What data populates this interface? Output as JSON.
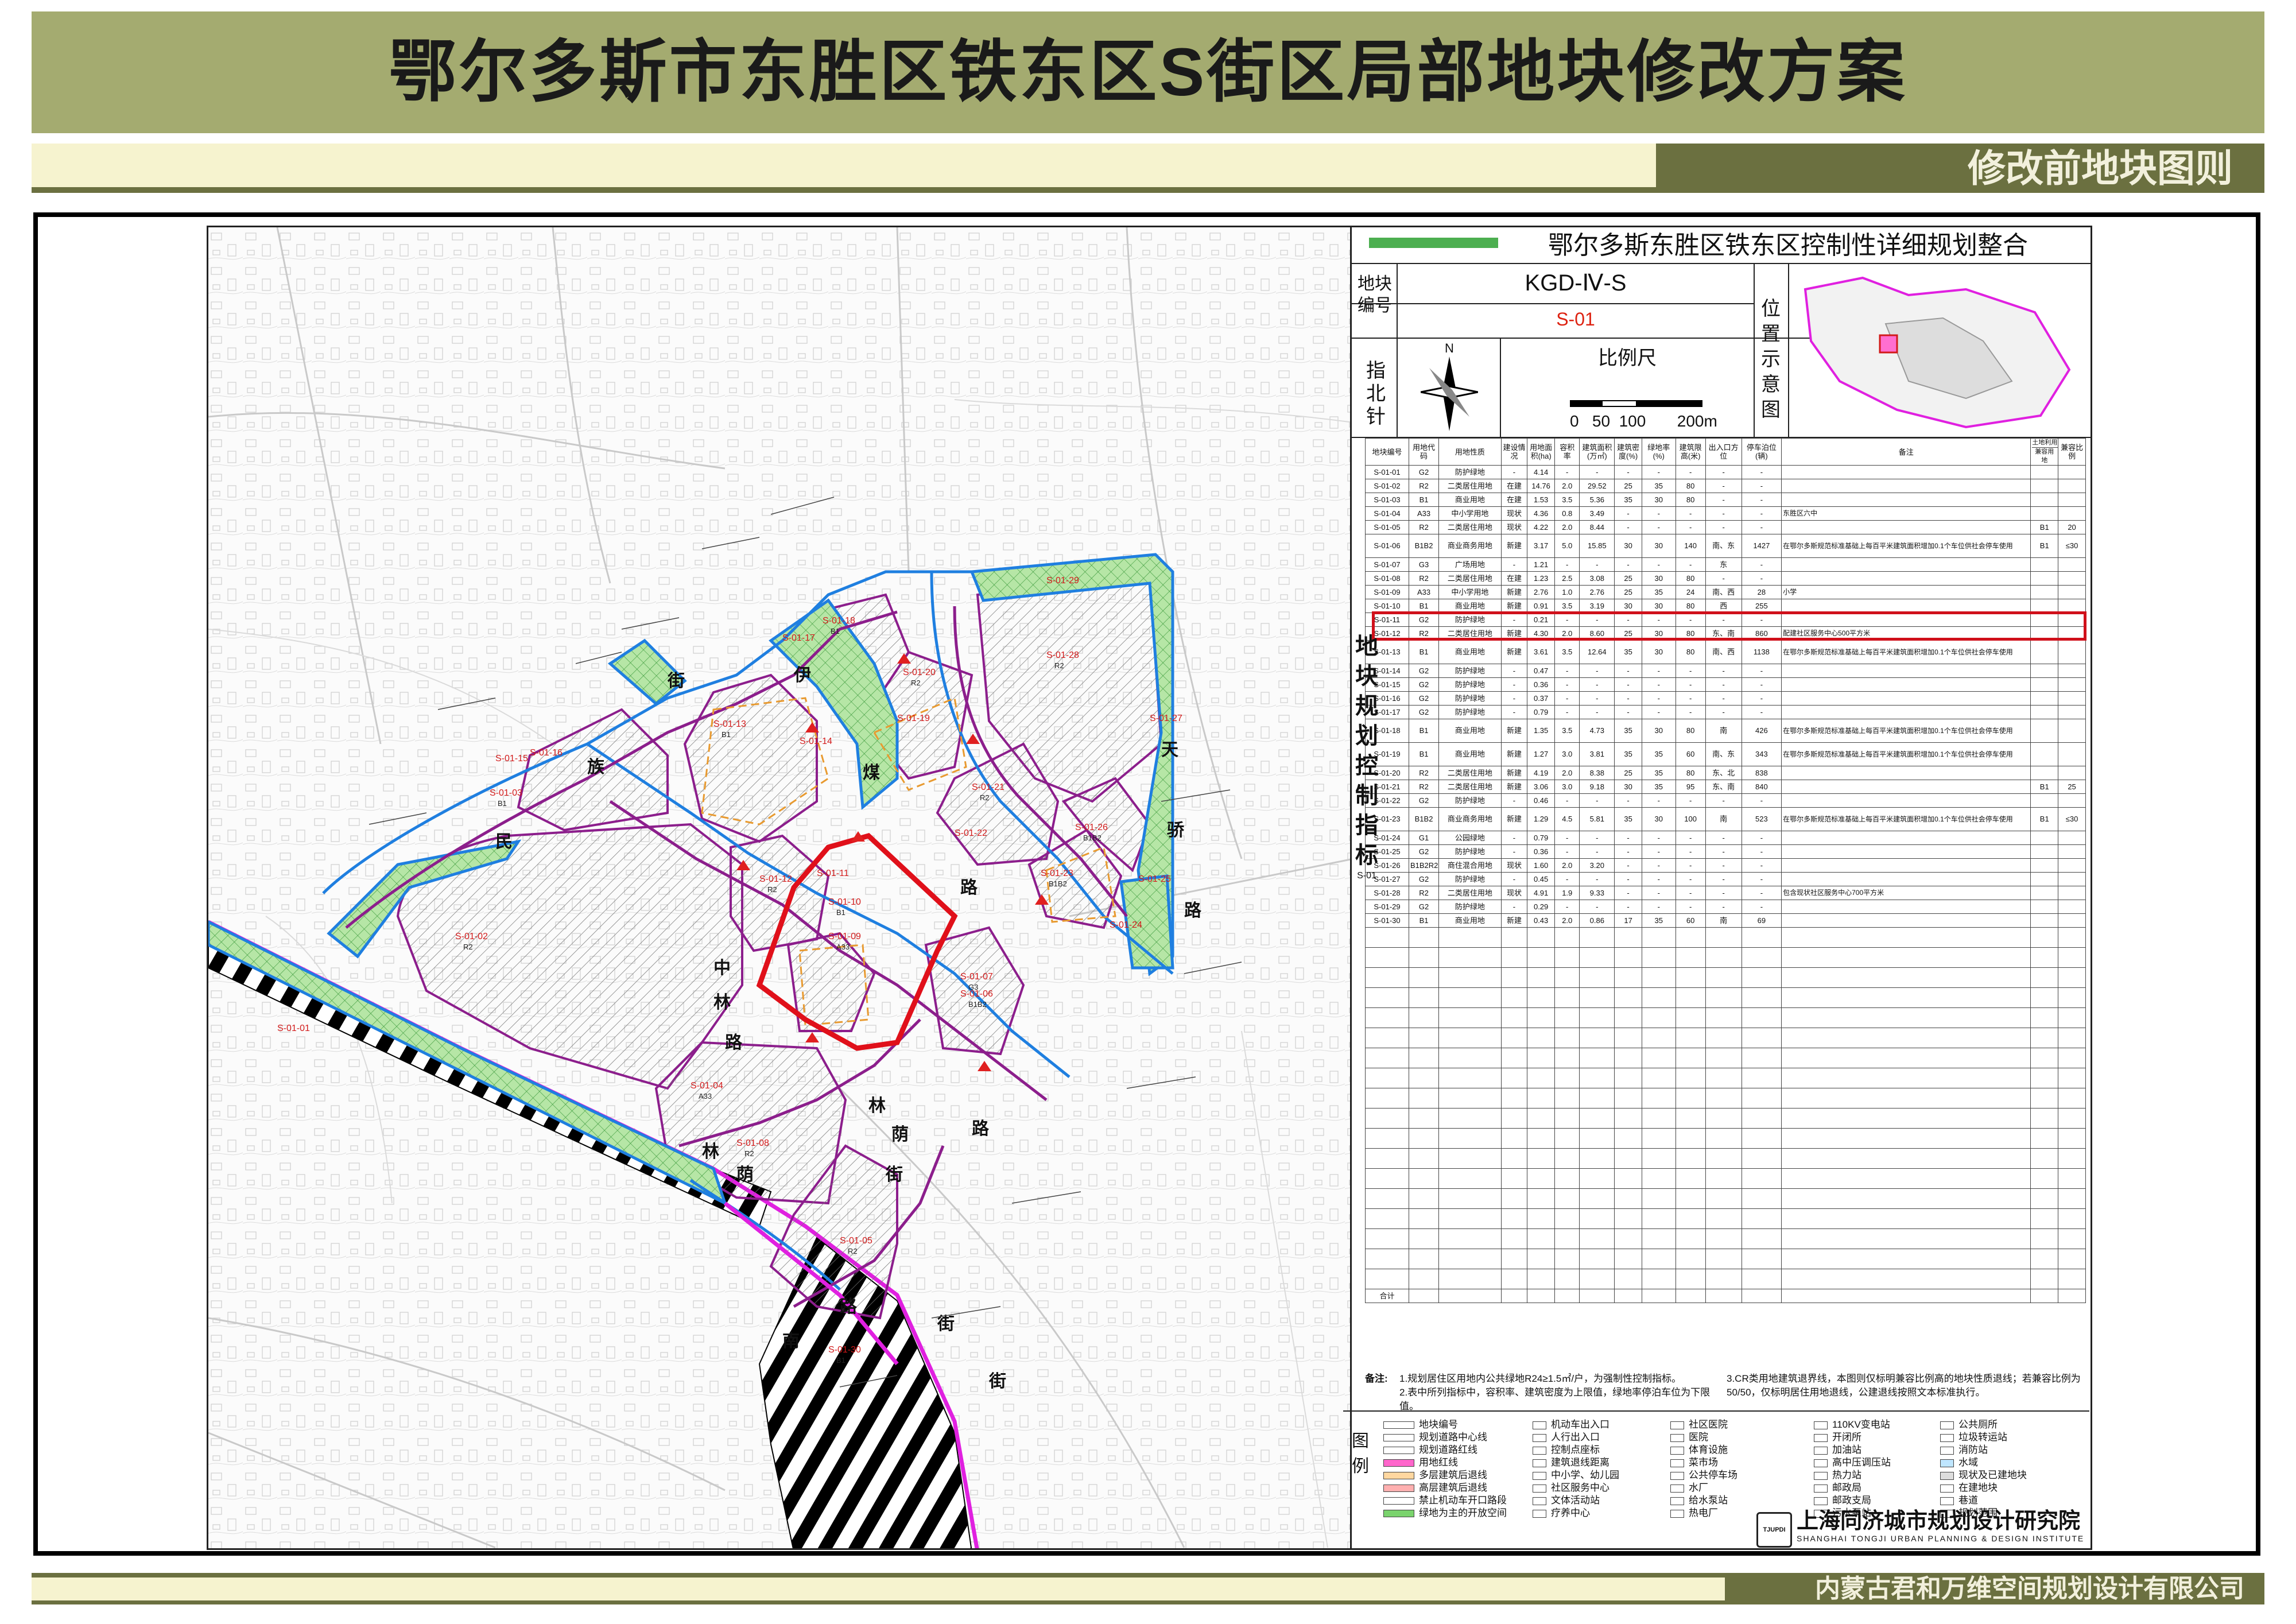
{
  "title": "鄂尔多斯市东胜区铁东区S街区局部地块修改方案",
  "subtitle": "修改前地块图则",
  "company": "内蒙古君和万维空间规划设计有限公司",
  "panel": {
    "title": "鄂尔多斯东胜区铁东区控制性详细规划整合",
    "block_label": "地块编号",
    "block_code": "KGD-Ⅳ-S",
    "block_sub": "S-01",
    "north_label": "指北针",
    "north_letter": "N",
    "scale_label": "比例尺",
    "scale_ticks": "0   50  100       200m",
    "location_label": "位置示意图",
    "vertical_label": "地块规划控制指标",
    "vertical_small": "S-01",
    "headers": [
      "地块编号",
      "用地代码",
      "用地性质",
      "建设情况",
      "用地面积(ha)",
      "容积率",
      "建筑面积(万㎡)",
      "建筑密度(%)",
      "绿地率(%)",
      "建筑限高(米)",
      "出入口方位",
      "停车泊位(辆)",
      "备注",
      "兼容用地",
      "兼容比例"
    ],
    "compat_header": "土地利用兼容性规定",
    "rows": [
      [
        "S-01-01",
        "G2",
        "防护绿地",
        "-",
        "4.14",
        "-",
        "-",
        "-",
        "-",
        "-",
        "-",
        "-",
        "",
        "",
        ""
      ],
      [
        "S-01-02",
        "R2",
        "二类居住用地",
        "在建",
        "14.76",
        "2.0",
        "29.52",
        "25",
        "35",
        "80",
        "-",
        "-",
        "",
        "",
        ""
      ],
      [
        "S-01-03",
        "B1",
        "商业用地",
        "在建",
        "1.53",
        "3.5",
        "5.36",
        "35",
        "30",
        "80",
        "-",
        "-",
        "",
        "",
        ""
      ],
      [
        "S-01-04",
        "A33",
        "中小学用地",
        "现状",
        "4.36",
        "0.8",
        "3.49",
        "-",
        "-",
        "-",
        "-",
        "-",
        "东胜区六中",
        "",
        ""
      ],
      [
        "S-01-05",
        "R2",
        "二类居住用地",
        "现状",
        "4.22",
        "2.0",
        "8.44",
        "-",
        "-",
        "-",
        "-",
        "-",
        "",
        "B1",
        "20"
      ],
      [
        "S-01-06",
        "B1B2",
        "商业商务用地",
        "新建",
        "3.17",
        "5.0",
        "15.85",
        "30",
        "30",
        "140",
        "南、东",
        "1427",
        "在鄂尔多斯规范标准基础上每百平米建筑面积增加0.1个车位供社会停车使用",
        "B1",
        "≤30"
      ],
      [
        "S-01-07",
        "G3",
        "广场用地",
        "-",
        "1.21",
        "-",
        "-",
        "-",
        "-",
        "-",
        "东",
        "-",
        "",
        "",
        ""
      ],
      [
        "S-01-08",
        "R2",
        "二类居住用地",
        "在建",
        "1.23",
        "2.5",
        "3.08",
        "25",
        "30",
        "80",
        "-",
        "-",
        "",
        "",
        ""
      ],
      [
        "S-01-09",
        "A33",
        "中小学用地",
        "新建",
        "2.76",
        "1.0",
        "2.76",
        "25",
        "35",
        "24",
        "南、西",
        "28",
        "小学",
        "",
        ""
      ],
      [
        "S-01-10",
        "B1",
        "商业用地",
        "新建",
        "0.91",
        "3.5",
        "3.19",
        "30",
        "30",
        "80",
        "西",
        "255",
        "",
        "",
        ""
      ],
      [
        "S-01-11",
        "G2",
        "防护绿地",
        "-",
        "0.21",
        "-",
        "-",
        "-",
        "-",
        "-",
        "-",
        "-",
        "",
        "",
        ""
      ],
      [
        "S-01-12",
        "R2",
        "二类居住用地",
        "新建",
        "4.30",
        "2.0",
        "8.60",
        "25",
        "30",
        "80",
        "东、南",
        "860",
        "配建社区服务中心500平方米",
        "",
        ""
      ],
      [
        "S-01-13",
        "B1",
        "商业用地",
        "新建",
        "3.61",
        "3.5",
        "12.64",
        "35",
        "30",
        "80",
        "南、西",
        "1138",
        "在鄂尔多斯规范标准基础上每百平米建筑面积增加0.1个车位供社会停车使用",
        "",
        ""
      ],
      [
        "S-01-14",
        "G2",
        "防护绿地",
        "-",
        "0.47",
        "-",
        "-",
        "-",
        "-",
        "-",
        "-",
        "-",
        "",
        "",
        ""
      ],
      [
        "S-01-15",
        "G2",
        "防护绿地",
        "-",
        "0.36",
        "-",
        "-",
        "-",
        "-",
        "-",
        "-",
        "-",
        "",
        "",
        ""
      ],
      [
        "S-01-16",
        "G2",
        "防护绿地",
        "-",
        "0.37",
        "-",
        "-",
        "-",
        "-",
        "-",
        "-",
        "-",
        "",
        "",
        ""
      ],
      [
        "S-01-17",
        "G2",
        "防护绿地",
        "-",
        "0.79",
        "-",
        "-",
        "-",
        "-",
        "-",
        "-",
        "-",
        "",
        "",
        ""
      ],
      [
        "S-01-18",
        "B1",
        "商业用地",
        "新建",
        "1.35",
        "3.5",
        "4.73",
        "35",
        "30",
        "80",
        "南",
        "426",
        "在鄂尔多斯规范标准基础上每百平米建筑面积增加0.1个车位供社会停车使用",
        "",
        ""
      ],
      [
        "S-01-19",
        "B1",
        "商业用地",
        "新建",
        "1.27",
        "3.0",
        "3.81",
        "35",
        "35",
        "60",
        "南、东",
        "343",
        "在鄂尔多斯规范标准基础上每百平米建筑面积增加0.1个车位供社会停车使用",
        "",
        ""
      ],
      [
        "S-01-20",
        "R2",
        "二类居住用地",
        "新建",
        "4.19",
        "2.0",
        "8.38",
        "25",
        "35",
        "80",
        "东、北",
        "838",
        "",
        "",
        ""
      ],
      [
        "S-01-21",
        "R2",
        "二类居住用地",
        "新建",
        "3.06",
        "3.0",
        "9.18",
        "30",
        "35",
        "95",
        "东、南",
        "840",
        "",
        "B1",
        "25"
      ],
      [
        "S-01-22",
        "G2",
        "防护绿地",
        "-",
        "0.46",
        "-",
        "-",
        "-",
        "-",
        "-",
        "-",
        "-",
        "",
        "",
        ""
      ],
      [
        "S-01-23",
        "B1B2",
        "商业商务用地",
        "新建",
        "1.29",
        "4.5",
        "5.81",
        "35",
        "30",
        "100",
        "南",
        "523",
        "在鄂尔多斯规范标准基础上每百平米建筑面积增加0.1个车位供社会停车使用",
        "B1",
        "≤30"
      ],
      [
        "S-01-24",
        "G1",
        "公园绿地",
        "-",
        "0.79",
        "-",
        "-",
        "-",
        "-",
        "-",
        "-",
        "-",
        "",
        "",
        ""
      ],
      [
        "S-01-25",
        "G2",
        "防护绿地",
        "-",
        "0.36",
        "-",
        "-",
        "-",
        "-",
        "-",
        "-",
        "-",
        "",
        "",
        ""
      ],
      [
        "S-01-26",
        "B1B2R2",
        "商住混合用地",
        "现状",
        "1.60",
        "2.0",
        "3.20",
        "-",
        "-",
        "-",
        "-",
        "-",
        "",
        "",
        ""
      ],
      [
        "S-01-27",
        "G2",
        "防护绿地",
        "-",
        "0.45",
        "-",
        "-",
        "-",
        "-",
        "-",
        "-",
        "-",
        "",
        "",
        ""
      ],
      [
        "S-01-28",
        "R2",
        "二类居住用地",
        "现状",
        "4.91",
        "1.9",
        "9.33",
        "-",
        "-",
        "-",
        "-",
        "-",
        "包含现状社区服务中心700平方米",
        "",
        ""
      ],
      [
        "S-01-29",
        "G2",
        "防护绿地",
        "-",
        "0.29",
        "-",
        "-",
        "-",
        "-",
        "-",
        "-",
        "-",
        "",
        "",
        ""
      ],
      [
        "S-01-30",
        "B1",
        "商业用地",
        "新建",
        "0.43",
        "2.0",
        "0.86",
        "17",
        "35",
        "60",
        "南",
        "69",
        "",
        "",
        ""
      ]
    ],
    "total_label": "合计",
    "notes_label": "备注:",
    "notes_left": [
      "1.规划居住区用地内公共绿地R24≥1.5㎡/户，为强制性控制指标。",
      "2.表中所列指标中，容积率、建筑密度为上限值，绿地率停泊车位为下限值。"
    ],
    "notes_right": [
      "3.CR类用地建筑退界线，本图则仅标明兼容比例高的地块性质退线；若兼容比例为50/50，仅标明居住用地退线，公建退线按照文本标准执行。"
    ],
    "legend_label": "图例",
    "legend": [
      {
        "t": "地块编号",
        "c": "#ffffff"
      },
      {
        "t": "规划道路中心线",
        "c": "#ffffff"
      },
      {
        "t": "规划道路红线",
        "c": "#ffffff"
      },
      {
        "t": "用地红线",
        "c": "#ff66cc"
      },
      {
        "t": "多层建筑后退线",
        "c": "#ffd7a0"
      },
      {
        "t": "高层建筑后退线",
        "c": "#ffb0b0"
      },
      {
        "t": "禁止机动车开口路段",
        "c": "#ffffff"
      },
      {
        "t": "绿地为主的开放空间",
        "c": "#7ad36d"
      },
      {
        "t": "机动车出入口",
        "c": "#ffffff"
      },
      {
        "t": "人行出入口",
        "c": "#ffffff"
      },
      {
        "t": "控制点座标",
        "c": "#ffffff"
      },
      {
        "t": "建筑退线距离",
        "c": "#ffffff"
      },
      {
        "t": "中小学、幼儿园",
        "c": "#ffffff"
      },
      {
        "t": "社区服务中心",
        "c": "#ffffff"
      },
      {
        "t": "文体活动站",
        "c": "#ffffff"
      },
      {
        "t": "疗养中心",
        "c": "#ffffff"
      },
      {
        "t": "社区医院",
        "c": "#ffffff"
      },
      {
        "t": "医院",
        "c": "#ffffff"
      },
      {
        "t": "体育设施",
        "c": "#ffffff"
      },
      {
        "t": "菜市场",
        "c": "#ffffff"
      },
      {
        "t": "公共停车场",
        "c": "#ffffff"
      },
      {
        "t": "水厂",
        "c": "#ffffff"
      },
      {
        "t": "给水泵站",
        "c": "#ffffff"
      },
      {
        "t": "热电厂",
        "c": "#ffffff"
      },
      {
        "t": "110KV变电站",
        "c": "#ffffff"
      },
      {
        "t": "开闭所",
        "c": "#ffffff"
      },
      {
        "t": "加油站",
        "c": "#ffffff"
      },
      {
        "t": "高中压调压站",
        "c": "#ffffff"
      },
      {
        "t": "热力站",
        "c": "#ffffff"
      },
      {
        "t": "邮政局",
        "c": "#ffffff"
      },
      {
        "t": "邮政支局",
        "c": "#ffffff"
      },
      {
        "t": "污水泵站",
        "c": "#ffffff"
      },
      {
        "t": "公共厕所",
        "c": "#ffffff"
      },
      {
        "t": "垃圾转运站",
        "c": "#ffffff"
      },
      {
        "t": "消防站",
        "c": "#ffffff"
      },
      {
        "t": "水域",
        "c": "#bfe6ff"
      },
      {
        "t": "现状及已建地块",
        "c": "#dddddd"
      },
      {
        "t": "在建地块",
        "c": "#ffffff"
      },
      {
        "t": "巷道",
        "c": "#ffffff"
      },
      {
        "t": "规划范围",
        "c": "#ffffff"
      }
    ],
    "institute_cn": "上海同济城市规划设计研究院",
    "institute_en": "SHANGHAI TONGJI URBAN PLANNING & DESIGN INSTITUTE",
    "institute_logo": "TJUPDI"
  },
  "map": {
    "parcel_labels": [
      {
        "id": "S-01-01",
        "sub": ""
      },
      {
        "id": "S-01-02",
        "sub": "R2"
      },
      {
        "id": "S-01-03",
        "sub": "B1"
      },
      {
        "id": "S-01-04",
        "sub": "A33"
      },
      {
        "id": "S-01-05",
        "sub": "R2"
      },
      {
        "id": "S-01-06",
        "sub": "B1B2"
      },
      {
        "id": "S-01-07",
        "sub": "G3"
      },
      {
        "id": "S-01-08",
        "sub": "R2"
      },
      {
        "id": "S-01-09",
        "sub": "A33"
      },
      {
        "id": "S-01-10",
        "sub": "B1"
      },
      {
        "id": "S-01-11",
        "sub": ""
      },
      {
        "id": "S-01-12",
        "sub": "R2"
      },
      {
        "id": "S-01-13",
        "sub": "B1"
      },
      {
        "id": "S-01-14",
        "sub": ""
      },
      {
        "id": "S-01-15",
        "sub": ""
      },
      {
        "id": "S-01-16",
        "sub": ""
      },
      {
        "id": "S-01-17",
        "sub": ""
      },
      {
        "id": "S-01-18",
        "sub": "B1"
      },
      {
        "id": "S-01-19",
        "sub": ""
      },
      {
        "id": "S-01-20",
        "sub": "R2"
      },
      {
        "id": "S-01-21",
        "sub": "R2"
      },
      {
        "id": "S-01-22",
        "sub": ""
      },
      {
        "id": "S-01-23",
        "sub": "B1B2"
      },
      {
        "id": "S-01-24",
        "sub": ""
      },
      {
        "id": "S-01-25",
        "sub": ""
      },
      {
        "id": "S-01-26",
        "sub": "B1B2"
      },
      {
        "id": "S-01-27",
        "sub": ""
      },
      {
        "id": "S-01-28",
        "sub": "R2"
      },
      {
        "id": "S-01-29",
        "sub": ""
      },
      {
        "id": "S-01-30",
        "sub": "B1"
      }
    ],
    "road_chars": [
      "街",
      "伊",
      "煤",
      "路",
      "民",
      "族",
      "天",
      "骄",
      "路",
      "中",
      "林",
      "路",
      "林",
      "荫",
      "路",
      "林",
      "荫",
      "街",
      "南",
      "路",
      "街",
      "街"
    ]
  }
}
